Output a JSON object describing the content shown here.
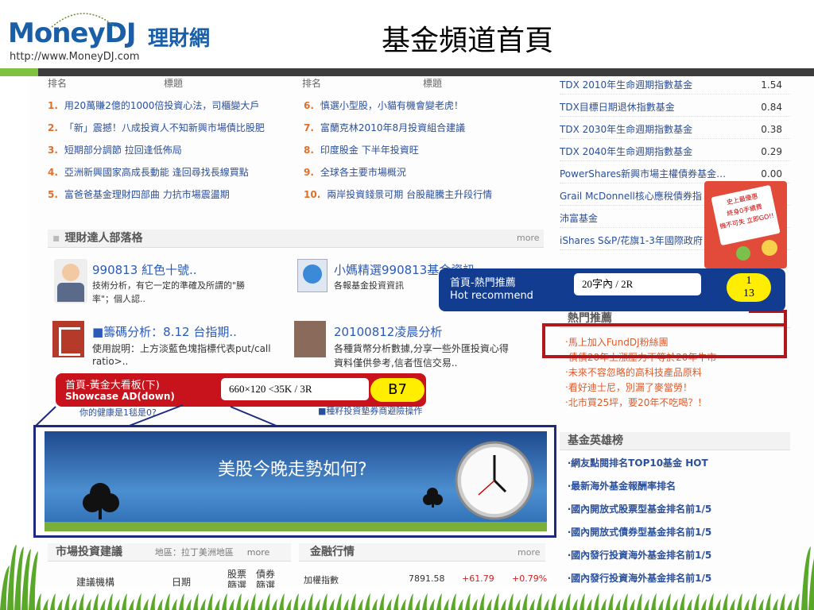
{
  "header": {
    "logo_main": "MoneyDJ",
    "logo_cn": "理財網",
    "logo_url": "http://www.MoneyDJ.com",
    "title": "基金頻道首頁"
  },
  "top_lists": {
    "col1_header_rank": "排名",
    "col1_header_title": "標題",
    "col2_header_rank": "排名",
    "col2_header_title": "標題",
    "left": [
      {
        "n": "1.",
        "t": "用20萬賺2億的1000倍投資心法，司櫃變大戶"
      },
      {
        "n": "2.",
        "t": "「新」震撼！八成投資人不知新興市場債比股肥"
      },
      {
        "n": "3.",
        "t": "短期部分調節 拉回逢低佈局"
      },
      {
        "n": "4.",
        "t": "亞洲新興國家高成長動能 逢回尋找長線買點"
      },
      {
        "n": "5.",
        "t": "富爸爸基金理財四部曲 力抗市場震盪期"
      }
    ],
    "right": [
      {
        "n": "6.",
        "t": "慎選小型股，小貓有機會變老虎！"
      },
      {
        "n": "7.",
        "t": "富蘭克林2010年8月投資組合建議"
      },
      {
        "n": "8.",
        "t": "印度股金 下半年投資旺"
      },
      {
        "n": "9.",
        "t": "全球各主要市場概況"
      },
      {
        "n": "10.",
        "t": "兩岸投資錢景可期 台股龍騰主升段行情"
      }
    ]
  },
  "funds": [
    {
      "name": "TDX 2010年生命週期指數基金",
      "val": "1.54"
    },
    {
      "name": "TDX目標日期退休指數基金",
      "val": "0.84"
    },
    {
      "name": "TDX 2030年生命週期指數基金",
      "val": "0.38"
    },
    {
      "name": "TDX 2040年生命週期指數基金",
      "val": "0.29"
    },
    {
      "name": "PowerShares新興市場主權債券基金…",
      "val": "0.00"
    },
    {
      "name": "Grail McDonnell核心應稅債券指",
      "val": ""
    },
    {
      "name": "沛富基金",
      "val": ""
    },
    {
      "name": "iShares S&P/花旗1-3年國際政府",
      "val": ""
    }
  ],
  "blog": {
    "section_title": "理財達人部落格",
    "more": "more",
    "entries": [
      {
        "title": "990813 紅色十號..",
        "desc1": "技術分析，有它一定的準確及所謂的\"勝",
        "desc2": "率\"；個人認.."
      },
      {
        "title": "小媽精選990813基金資訊",
        "desc1": "各報基金投資資訊",
        "desc2": ""
      },
      {
        "title": "■籌碼分析：8.12 台指期..",
        "desc1": "使用說明：上方淡藍色塊指標代表put/call",
        "desc2": "ratio>.."
      },
      {
        "title": "20100812凌晨分析",
        "desc1": "各種貨幣分析數據,分享一些外匯投資心得",
        "desc2": "資料僅供參考,信者恆信交易.."
      }
    ],
    "small1": "你的健康是1毯是0?",
    "small2": "■種籽投資墊券商避險操作"
  },
  "hot": {
    "section_title": "熱門推薦",
    "items": [
      "‧馬上加入FundDJ粉絲團",
      "‧債債20年上漲壓力不等於20年牛市",
      "‧未來不容忽略的高科技產品原料",
      "‧看好迪士尼，別漏了麥當勞！",
      "‧北市買25坪，要20年不吃喝？！"
    ]
  },
  "heroes": {
    "section_title": "基金英雄榜",
    "items": [
      "‧網友點閱排名TOP10基金 HOT",
      "‧最新海外基金報酬率排名",
      "‧國內開放式股票型基金排名前1/5",
      "‧國內開放式債券型基金排名前1/5",
      "‧國內發行投資海外基金排名前1/5",
      "‧國內發行投資海外基金排名前1/5"
    ]
  },
  "market": {
    "section_title": "市場投資建議",
    "region": "地區：拉丁美洲地區",
    "more": "more",
    "col1": "建議機構",
    "col2": "日期",
    "col3": "股票篩選",
    "col4": "債券篩選"
  },
  "finance": {
    "section_title": "金融行情",
    "more": "more",
    "row_name": "加權指數",
    "row_val": "7891.58",
    "row_chg": "+61.79",
    "row_pct": "+0.79%"
  },
  "banner": {
    "text": "美股今晚走勢如何?"
  },
  "ad_side": {
    "line1": "史上最優惠",
    "line2": "終身0手續費",
    "line3": "機不可失 立即GO!!"
  },
  "callout_b13": {
    "label_cn": "首頁-熱門推薦",
    "label_en": "Hot  recommend",
    "spec": "20字內 / 2R",
    "code": "13"
  },
  "callout_b7": {
    "label_cn": "首頁-黃金大看板(下)",
    "label_en": "Showcase AD(down)",
    "spec": "660×120 <35K / 3R",
    "code": "B7"
  },
  "colors": {
    "callout_blue": "#123c8f",
    "callout_red": "#c8121c",
    "highlight_red": "#b0181e",
    "highlight_navy": "#1b2a80",
    "pill_yellow": "#ffee00",
    "grass_green": "#5aa82a"
  }
}
